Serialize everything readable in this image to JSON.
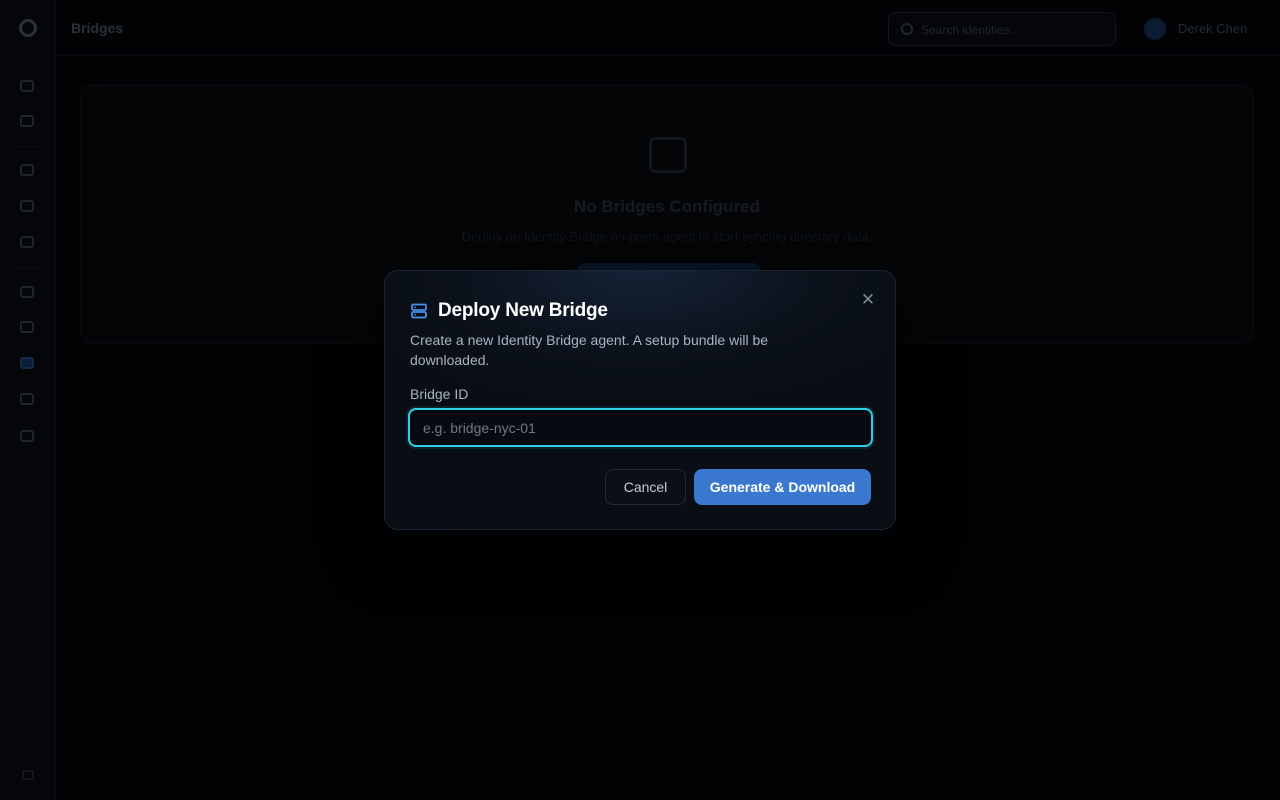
{
  "topbar": {
    "page_title": "Bridges",
    "search_placeholder": "Search identities...",
    "user_name": "Derek Chen"
  },
  "empty_state": {
    "title": "No Bridges Configured",
    "description": "Deploy an Identity Bridge on-prem agent to start syncing directory data."
  },
  "modal": {
    "title": "Deploy New Bridge",
    "description": "Create a new Identity Bridge agent. A setup bundle will be downloaded.",
    "field_label": "Bridge ID",
    "input_placeholder": "e.g. bridge-nyc-01",
    "input_value": "",
    "cancel_label": "Cancel",
    "submit_label": "Generate & Download",
    "close_glyph": "✕"
  },
  "colors": {
    "accent": "#3a78d0",
    "focus_ring": "#2fd0e8",
    "icon_blue": "#4a8fe8"
  },
  "icons": {
    "modal_header": "server-icon",
    "close": "close-icon"
  }
}
